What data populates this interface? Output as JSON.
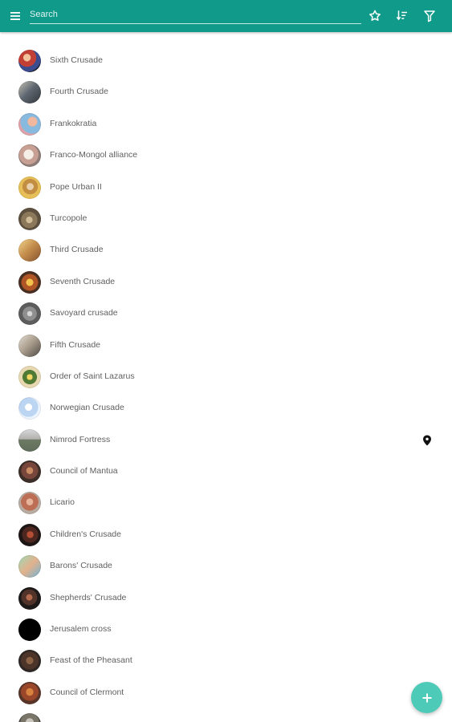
{
  "colors": {
    "toolbar": "#109a8a",
    "fab": "#4ecab8",
    "label": "#5f5f5f",
    "icon": "#ffffff"
  },
  "header": {
    "search_placeholder": "Search",
    "icons": [
      "menu-icon",
      "star-icon",
      "sort-icon",
      "filter-icon"
    ]
  },
  "list": {
    "items": [
      {
        "label": "Sixth Crusade",
        "avatar_bg": "radial-gradient(circle at 38% 35%, #f1c29b 0 18%, #c23f36 19% 45%, #3a4c8e 46% 70%, #1d2130 71%)"
      },
      {
        "label": "Fourth Crusade",
        "avatar_bg": "linear-gradient(135deg, #c7c2b6 0%, #5d6670 48%, #34363b 100%)"
      },
      {
        "label": "Frankokratia",
        "avatar_bg": "radial-gradient(circle at 62% 38%, #f0b79e 0 24%, #88b9de 25% 60%, #dda3a8 61%)"
      },
      {
        "label": "Franco-Mongol alliance",
        "avatar_bg": "radial-gradient(circle at 45% 45%, #f4eee6 0 28%, #c79f93 29% 56%, #8f7d78 57%)"
      },
      {
        "label": "Pope Urban II",
        "avatar_bg": "radial-gradient(circle at 52% 45%, #e8d0ad 0 20%, #c38d42 21% 45%, #e7bf58 46%)"
      },
      {
        "label": "Turcopole",
        "avatar_bg": "radial-gradient(circle at 48% 54%, #d0bc96 0 19%, #8b7759 20% 48%, #5e503e 49%)"
      },
      {
        "label": "Third Crusade",
        "avatar_bg": "linear-gradient(135deg, #f2d48d 0%, #c48d4c 48%, #85512e 100%)"
      },
      {
        "label": "Seventh Crusade",
        "avatar_bg": "radial-gradient(circle at 50% 50%, #f4c34b 0 22%, #b05525 23% 52%, #4a2f23 53%)"
      },
      {
        "label": "Savoyard crusade",
        "avatar_bg": "radial-gradient(circle at 50% 50%, #d5d5d5 0 16%, #8f8f8f 17% 44%, #5d5d5d 45%)"
      },
      {
        "label": "Fifth Crusade",
        "avatar_bg": "linear-gradient(135deg, #e6dfd5 0%, #a89c8c 48%, #4d4944 100%)"
      },
      {
        "label": "Order of Saint Lazarus",
        "avatar_bg": "radial-gradient(circle at 50% 50%, #f5d564 0 18%, #517a34 19% 45%, #e7d8b1 46%)"
      },
      {
        "label": "Norwegian Crusade",
        "avatar_bg": "radial-gradient(circle at 45% 45%, #ffffff 0 20%, #bcd5f2 21% 55%, #eef5ff 56%)"
      },
      {
        "label": "Nimrod Fortress",
        "avatar_bg": "linear-gradient(180deg, #d7d8da 0%, #b2b0ad 45%, #6d7b64 46%, #5f6d5b 100%)",
        "has_pin": true
      },
      {
        "label": "Council of Mantua",
        "avatar_bg": "radial-gradient(circle at 50% 45%, #c88b62 0 20%, #78463a 21% 50%, #3e2e28 51%)"
      },
      {
        "label": "Licario",
        "avatar_bg": "radial-gradient(circle at 50% 45%, #e6b49b 0 20%, #bd6f56 21% 52%, #b9aca3 53%)"
      },
      {
        "label": "Children's Crusade",
        "avatar_bg": "radial-gradient(circle at 52% 48%, #b64e36 0 20%, #4e2820 21% 48%, #1f1716 49%)"
      },
      {
        "label": "Barons' Crusade",
        "avatar_bg": "linear-gradient(135deg, #9cdcb6 0%, #e2b18c 50%, #6eb3d6 100%)"
      },
      {
        "label": "Shepherds' Crusade",
        "avatar_bg": "radial-gradient(circle at 48% 45%, #b46a4d 0 18%, #523329 19% 46%, #1f1a1a 47%)"
      },
      {
        "label": "Jerusalem cross",
        "avatar_bg": "#000000"
      },
      {
        "label": "Feast of the Pheasant",
        "avatar_bg": "radial-gradient(circle at 50% 48%, #8a6246 0 22%, #4d3429 23% 54%, #2f2723 55%)"
      },
      {
        "label": "Council of Clermont",
        "avatar_bg": "radial-gradient(circle at 50% 45%, #d8823f 0 22%, #99462b 23% 52%, #593528 53%)"
      },
      {
        "label": "",
        "avatar_bg": "radial-gradient(circle at 50% 40%, #c9c4bc 0 22%, #7a7569 23% 52%, #4d4b46 53%)"
      }
    ]
  },
  "fab": {
    "icon": "add-icon"
  }
}
